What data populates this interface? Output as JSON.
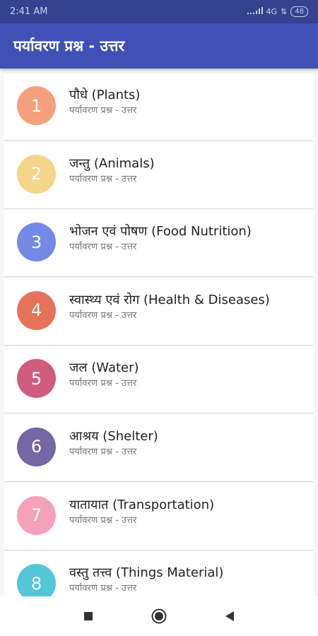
{
  "status_bar": {
    "time": "2:41 AM",
    "network": "4G",
    "battery": "48"
  },
  "app_bar": {
    "title": "पर्यावरण प्रश्न - उत्तर"
  },
  "list": {
    "items": [
      {
        "number": "1",
        "title": "पौधे (Plants)",
        "subtitle": "पर्यावरण प्रश्न - उत्तर",
        "color": "#f4a07c"
      },
      {
        "number": "2",
        "title": "जन्तु (Animals)",
        "subtitle": "पर्यावरण प्रश्न - उत्तर",
        "color": "#f5d58a"
      },
      {
        "number": "3",
        "title": "भोजन एवं पोषण (Food Nutrition)",
        "subtitle": "पर्यावरण प्रश्न - उत्तर",
        "color": "#7589e6"
      },
      {
        "number": "4",
        "title": "स्वास्थ्य एवं रोग (Health & Diseases)",
        "subtitle": "पर्यावरण प्रश्न - उत्तर",
        "color": "#e5735a"
      },
      {
        "number": "5",
        "title": "जल (Water)",
        "subtitle": "पर्यावरण प्रश्न - उत्तर",
        "color": "#cf5c7c"
      },
      {
        "number": "6",
        "title": "आश्रय (Shelter)",
        "subtitle": "पर्यावरण प्रश्न - उत्तर",
        "color": "#7566a5"
      },
      {
        "number": "7",
        "title": "यातायात (Transportation)",
        "subtitle": "पर्यावरण प्रश्न - उत्तर",
        "color": "#f4a2bb"
      },
      {
        "number": "8",
        "title": "वस्तु तत्त्व (Things Material)",
        "subtitle": "पर्यावरण प्रश्न - उत्तर",
        "color": "#55c6d6"
      }
    ]
  },
  "nav_bar": {
    "icons": [
      "recents-square-icon",
      "home-circle-icon",
      "back-triangle-icon"
    ]
  }
}
